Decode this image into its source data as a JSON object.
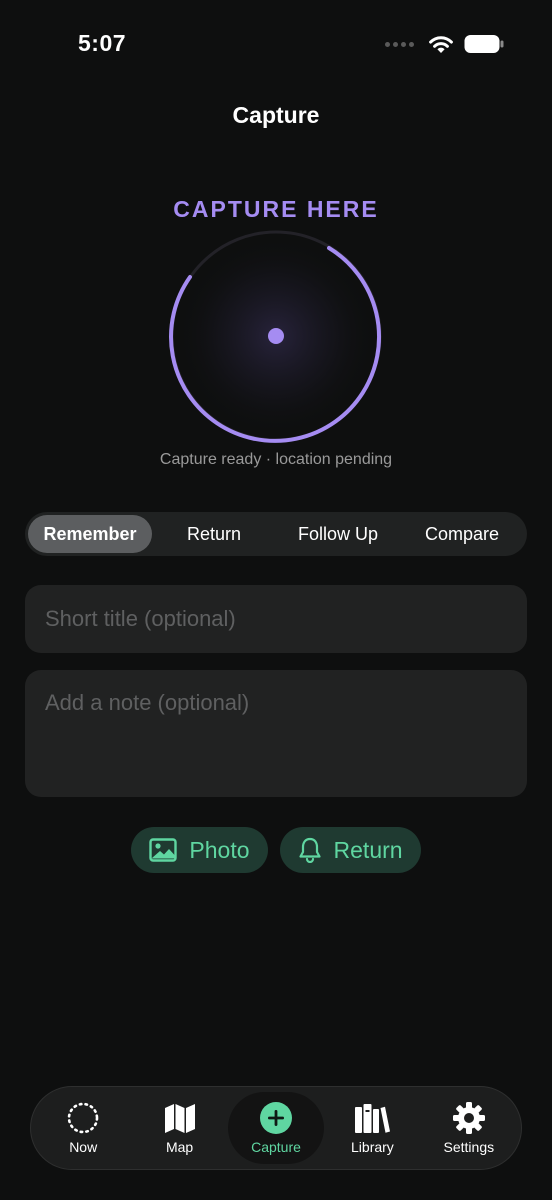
{
  "status_bar": {
    "time": "5:07",
    "icons": [
      "cellular-signal-icon",
      "wifi-icon",
      "battery-icon"
    ]
  },
  "nav": {
    "title": "Capture"
  },
  "capture": {
    "heading": "CAPTURE HERE",
    "status": "Capture ready · location pending",
    "accent_color": "#a58cf2"
  },
  "segments": {
    "items": [
      "Remember",
      "Return",
      "Follow Up",
      "Compare"
    ],
    "selected": "Remember"
  },
  "form": {
    "title_placeholder": "Short title (optional)",
    "note_placeholder": "Add a note (optional)"
  },
  "actions": {
    "photo_label": "Photo",
    "return_label": "Return",
    "chip_color": "#5fd6a1",
    "icons": [
      "photo-icon",
      "bell-icon"
    ]
  },
  "tabbar": {
    "items": [
      {
        "label": "Now",
        "icon": "dotted-circle-icon"
      },
      {
        "label": "Map",
        "icon": "map-icon"
      },
      {
        "label": "Capture",
        "icon": "plus-circle-icon"
      },
      {
        "label": "Library",
        "icon": "books-icon"
      },
      {
        "label": "Settings",
        "icon": "gear-icon"
      }
    ],
    "selected": "Capture",
    "active_color": "#5fd6a1"
  }
}
